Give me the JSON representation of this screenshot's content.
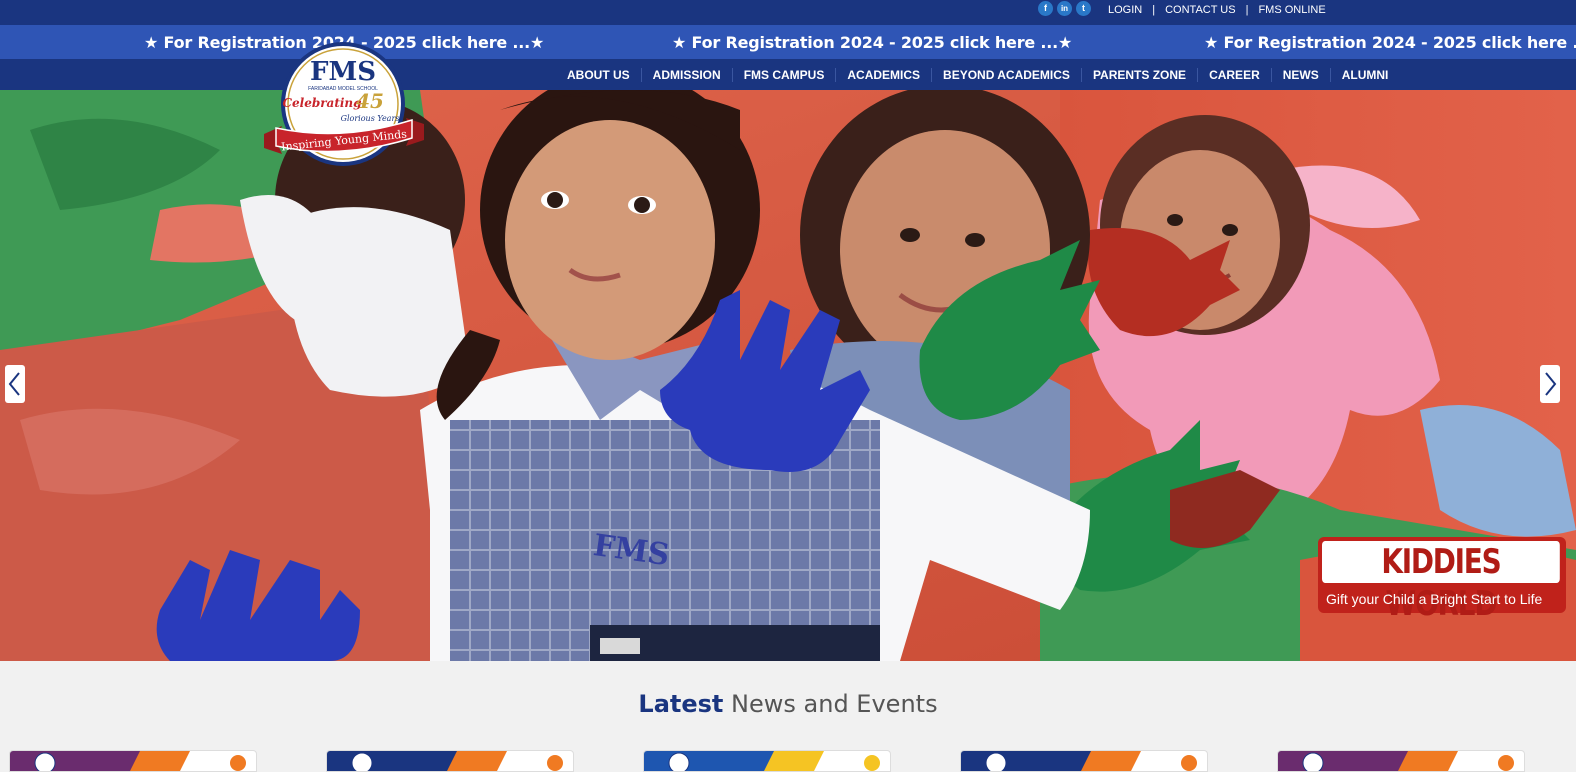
{
  "topbar": {
    "social": [
      {
        "icon": "facebook-icon",
        "glyph": "f"
      },
      {
        "icon": "linkedin-icon",
        "glyph": "in"
      },
      {
        "icon": "twitter-icon",
        "glyph": "t"
      }
    ],
    "login": "LOGIN",
    "contact": "CONTACT US",
    "fms_online": "FMS ONLINE",
    "separator": "|"
  },
  "marquee": {
    "text": "★ For Registration 2024 - 2025 click here ...★"
  },
  "nav": {
    "items": [
      "ABOUT US",
      "ADMISSION",
      "FMS CAMPUS",
      "ACADEMICS",
      "BEYOND ACADEMICS",
      "PARENTS ZONE",
      "CAREER",
      "NEWS",
      "ALUMNI"
    ]
  },
  "logo": {
    "brand": "FMS",
    "school": "FARIDABAD MODEL SCHOOL",
    "celebrating": "Celebrating",
    "years": "45",
    "glorious": "Glorious Years",
    "tagline": "Inspiring Young Minds"
  },
  "hero": {
    "badge_title": "KIDDIES WORLD",
    "badge_sub": "Gift your Child a Bright Start to Life",
    "apron_text": "FMS"
  },
  "news": {
    "heading_strong": "Latest",
    "heading_rest": "News and Events"
  },
  "colors": {
    "navy": "#1a3580",
    "marquee_blue": "#2f55b5",
    "badge_red": "#c0221b"
  }
}
